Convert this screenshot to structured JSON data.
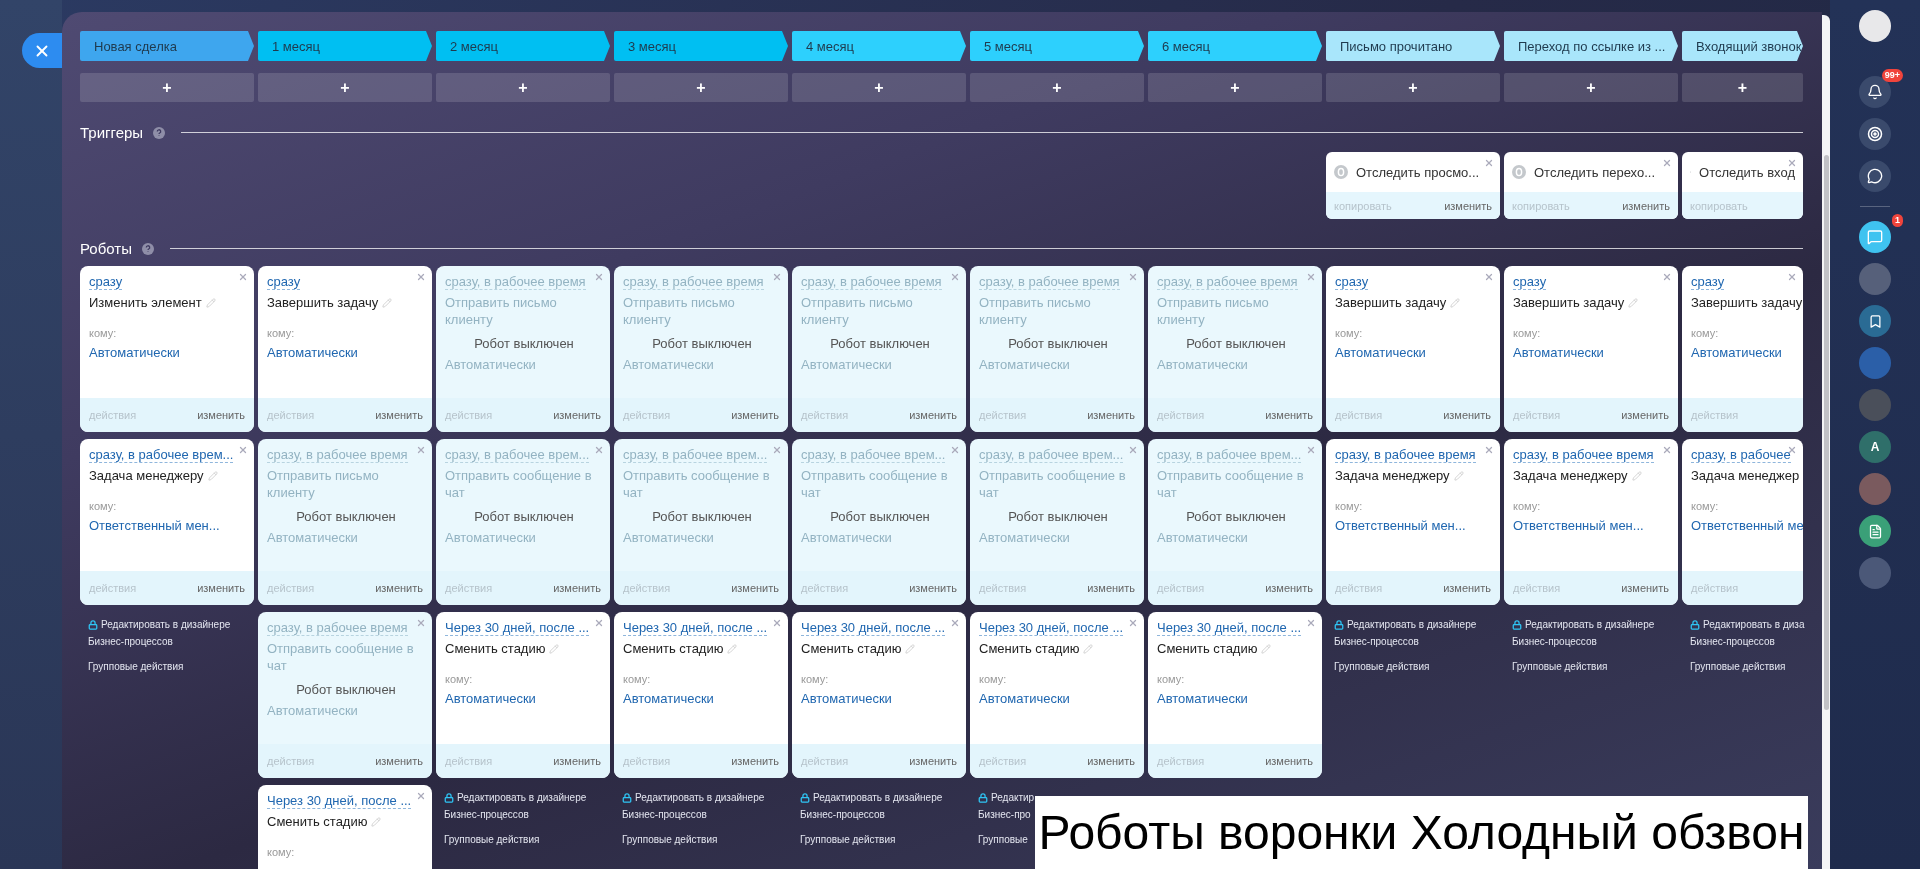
{
  "headings": {
    "triggers": "Триггеры",
    "robots": "Роботы"
  },
  "columns": [
    {
      "stage": "Новая сделка",
      "color": "#3ea6ee",
      "add": "+",
      "robots": [
        {
          "kind": "active",
          "condition": "сразу",
          "title": "Изменить элемент",
          "to_label": "кому:",
          "to_value": "Автоматически",
          "actions_label": "действия",
          "edit_label": "изменить"
        },
        {
          "kind": "active",
          "condition": "сразу, в рабочее врем...",
          "title": "Задача менеджеру",
          "to_label": "кому:",
          "to_value": "Ответственный мен...",
          "actions_label": "действия",
          "edit_label": "изменить"
        }
      ],
      "footer": {
        "designer": "Редактировать в дизайнере",
        "designer_2": "Бизнес-процессов",
        "group": "Групповые действия"
      }
    },
    {
      "stage": "1 месяц",
      "color": "#00bff2",
      "add": "+",
      "robots": [
        {
          "kind": "active",
          "condition": "сразу",
          "title": "Завершить задачу",
          "to_label": "кому:",
          "to_value": "Автоматически",
          "actions_label": "действия",
          "edit_label": "изменить"
        },
        {
          "kind": "disabled",
          "condition": "сразу, в рабочее время",
          "title": "Отправить письмо клиенту",
          "status": "Робот выключен",
          "to_value": "Автоматически",
          "actions_label": "действия",
          "edit_label": "изменить"
        },
        {
          "kind": "disabled",
          "condition": "сразу, в рабочее время",
          "title": "Отправить сообщение в чат",
          "status": "Робот выключен",
          "to_value": "Автоматически",
          "actions_label": "действия",
          "edit_label": "изменить"
        },
        {
          "kind": "active",
          "condition": "Через 30 дней, после ...",
          "title": "Сменить стадию",
          "to_label": "кому:"
        }
      ]
    },
    {
      "stage": "2 месяц",
      "color": "#00bff2",
      "add": "+",
      "robots": [
        {
          "kind": "disabled",
          "condition": "сразу, в рабочее время",
          "title": "Отправить письмо клиенту",
          "status": "Робот выключен",
          "to_value": "Автоматически",
          "actions_label": "действия",
          "edit_label": "изменить"
        },
        {
          "kind": "disabled",
          "condition": "сразу, в рабочее врем...",
          "title": "Отправить сообщение в чат",
          "status": "Робот выключен",
          "to_value": "Автоматически",
          "actions_label": "действия",
          "edit_label": "изменить"
        },
        {
          "kind": "active",
          "condition": "Через 30 дней, после ...",
          "title": "Сменить стадию",
          "to_label": "кому:",
          "to_value": "Автоматически",
          "actions_label": "действия",
          "edit_label": "изменить"
        }
      ],
      "footer": {
        "designer": "Редактировать в дизайнере",
        "designer_2": "Бизнес-процессов",
        "group": "Групповые действия"
      }
    },
    {
      "stage": "3 месяц",
      "color": "#00bff2",
      "add": "+",
      "robots": [
        {
          "kind": "disabled",
          "condition": "сразу, в рабочее время",
          "title": "Отправить письмо клиенту",
          "status": "Робот выключен",
          "to_value": "Автоматически",
          "actions_label": "действия",
          "edit_label": "изменить"
        },
        {
          "kind": "disabled",
          "condition": "сразу, в рабочее врем...",
          "title": "Отправить сообщение в чат",
          "status": "Робот выключен",
          "to_value": "Автоматически",
          "actions_label": "действия",
          "edit_label": "изменить"
        },
        {
          "kind": "active",
          "condition": "Через 30 дней, после ...",
          "title": "Сменить стадию",
          "to_label": "кому:",
          "to_value": "Автоматически",
          "actions_label": "действия",
          "edit_label": "изменить"
        }
      ],
      "footer": {
        "designer": "Редактировать в дизайнере",
        "designer_2": "Бизнес-процессов",
        "group": "Групповые действия"
      }
    },
    {
      "stage": "4 месяц",
      "color": "#2dd0fd",
      "add": "+",
      "robots": [
        {
          "kind": "disabled",
          "condition": "сразу, в рабочее время",
          "title": "Отправить письмо клиенту",
          "status": "Робот выключен",
          "to_value": "Автоматически",
          "actions_label": "действия",
          "edit_label": "изменить"
        },
        {
          "kind": "disabled",
          "condition": "сразу, в рабочее врем...",
          "title": "Отправить сообщение в чат",
          "status": "Робот выключен",
          "to_value": "Автоматически",
          "actions_label": "действия",
          "edit_label": "изменить"
        },
        {
          "kind": "active",
          "condition": "Через 30 дней, после ...",
          "title": "Сменить стадию",
          "to_label": "кому:",
          "to_value": "Автоматически",
          "actions_label": "действия",
          "edit_label": "изменить"
        }
      ],
      "footer": {
        "designer": "Редактировать в дизайнере",
        "designer_2": "Бизнес-процессов",
        "group": "Групповые действия"
      }
    },
    {
      "stage": "5 месяц",
      "color": "#2dd0fd",
      "add": "+",
      "robots": [
        {
          "kind": "disabled",
          "condition": "сразу, в рабочее время",
          "title": "Отправить письмо клиенту",
          "status": "Робот выключен",
          "to_value": "Автоматически",
          "actions_label": "действия",
          "edit_label": "изменить"
        },
        {
          "kind": "disabled",
          "condition": "сразу, в рабочее врем...",
          "title": "Отправить сообщение в чат",
          "status": "Робот выключен",
          "to_value": "Автоматически",
          "actions_label": "действия",
          "edit_label": "изменить"
        },
        {
          "kind": "active",
          "condition": "Через 30 дней, после ...",
          "title": "Сменить стадию",
          "to_label": "кому:",
          "to_value": "Автоматически",
          "actions_label": "действия",
          "edit_label": "изменить"
        }
      ],
      "footer": {
        "designer": "Редактир",
        "designer_2": "Бизнес-про",
        "group": "Групповые"
      }
    },
    {
      "stage": "6 месяц",
      "color": "#2dd0fd",
      "add": "+",
      "robots": [
        {
          "kind": "disabled",
          "condition": "сразу, в рабочее время",
          "title": "Отправить письмо клиенту",
          "status": "Робот выключен",
          "to_value": "Автоматически",
          "actions_label": "действия",
          "edit_label": "изменить"
        },
        {
          "kind": "disabled",
          "condition": "сразу, в рабочее врем...",
          "title": "Отправить сообщение в чат",
          "status": "Робот выключен",
          "to_value": "Автоматически",
          "actions_label": "действия",
          "edit_label": "изменить"
        },
        {
          "kind": "active",
          "condition": "Через 30 дней, после ...",
          "title": "Сменить стадию",
          "to_label": "кому:",
          "to_value": "Автоматически",
          "actions_label": "действия",
          "edit_label": "изменить"
        }
      ]
    },
    {
      "stage": "Письмо прочитано",
      "color": "#a9e6fb",
      "add": "+",
      "trigger": {
        "title": "Отследить просмо...",
        "copy_label": "копировать",
        "edit_label": "изменить"
      },
      "robots": [
        {
          "kind": "active",
          "condition": "сразу",
          "title": "Завершить задачу",
          "to_label": "кому:",
          "to_value": "Автоматически",
          "actions_label": "действия",
          "edit_label": "изменить"
        },
        {
          "kind": "active",
          "condition": "сразу, в рабочее время",
          "title": "Задача менеджеру",
          "to_label": "кому:",
          "to_value": "Ответственный мен...",
          "actions_label": "действия",
          "edit_label": "изменить"
        }
      ],
      "footer": {
        "designer": "Редактировать в дизайнере",
        "designer_2": "Бизнес-процессов",
        "group": "Групповые действия"
      }
    },
    {
      "stage": "Переход по ссылке из ...",
      "color": "#a9e6fb",
      "add": "+",
      "trigger": {
        "title": "Отследить перехо...",
        "copy_label": "копировать",
        "edit_label": "изменить"
      },
      "robots": [
        {
          "kind": "active",
          "condition": "сразу",
          "title": "Завершить задачу",
          "to_label": "кому:",
          "to_value": "Автоматически",
          "actions_label": "действия",
          "edit_label": "изменить"
        },
        {
          "kind": "active",
          "condition": "сразу, в рабочее время",
          "title": "Задача менеджеру",
          "to_label": "кому:",
          "to_value": "Ответственный мен...",
          "actions_label": "действия",
          "edit_label": "изменить"
        }
      ],
      "footer": {
        "designer": "Редактировать в дизайнере",
        "designer_2": "Бизнес-процессов",
        "group": "Групповые действия"
      }
    },
    {
      "stage": "Входящий звонок",
      "color": "#a9e6fb",
      "add": "+",
      "trigger": {
        "title": "Отследить вход",
        "copy_label": "копировать"
      },
      "robots": [
        {
          "kind": "active",
          "condition": "сразу",
          "title": "Завершить задачу",
          "to_label": "кому:",
          "to_value": "Автоматически",
          "actions_label": "действия"
        },
        {
          "kind": "active",
          "condition": "сразу, в рабочее",
          "title": "Задача менеджер",
          "to_label": "кому:",
          "to_value": "Ответственный ме",
          "actions_label": "действия"
        }
      ],
      "footer": {
        "designer": "Редактировать в диза",
        "designer_2": "Бизнес-процессов",
        "group": "Групповые действия"
      }
    }
  ],
  "caption": "Роботы воронки Холодный обзвон",
  "right_bar": {
    "notifications_badge": "99+",
    "chat_badge": "1",
    "user_initial": "A"
  }
}
